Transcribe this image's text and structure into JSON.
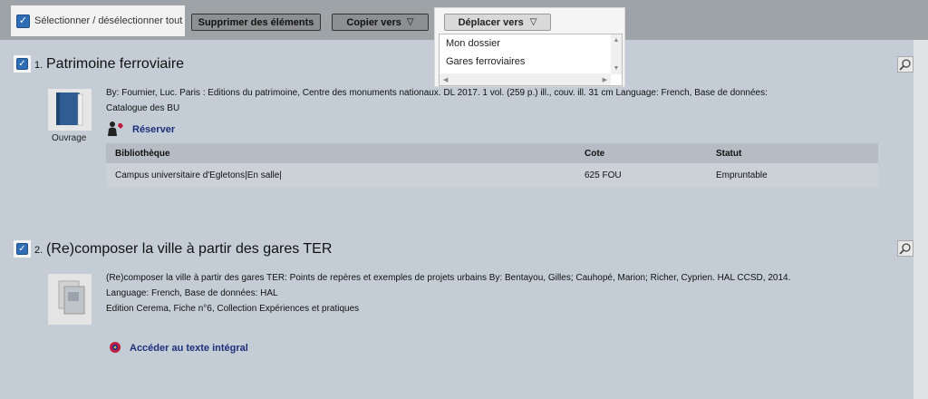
{
  "toolbar": {
    "select_all_label": "Sélectionner / désélectionner tout",
    "delete_label": "Supprimer des éléments",
    "copy_label": "Copier vers",
    "move_label": "Déplacer vers",
    "move_options": [
      "Mon dossier",
      "Gares ferroviaires"
    ]
  },
  "records": [
    {
      "number": "1.",
      "title": "Patrimoine ferroviaire",
      "type_label": "Ouvrage",
      "meta_line1": "By: Fournier, Luc. Paris : Editions du patrimoine, Centre des monuments nationaux. DL 2017. 1 vol. (259 p.) ill., couv. ill. 31 cm Language: French, Base de données:",
      "meta_line2": "Catalogue des BU",
      "reserve_label": "Réserver",
      "holdings": {
        "headers": [
          "Bibliothèque",
          "Cote",
          "Statut"
        ],
        "rows": [
          [
            "Campus universitaire d'Egletons|En salle|",
            "625 FOU",
            "Empruntable"
          ]
        ]
      }
    },
    {
      "number": "2.",
      "title": "(Re)composer la ville à partir des gares TER",
      "meta_line1": "(Re)composer la ville à partir des gares TER: Points de repères et exemples de projets urbains By: Bentayou, Gilles; Cauhopé, Marion; Richer, Cyprien. HAL CCSD, 2014.",
      "meta_line2": "Language: French, Base de données: HAL",
      "meta_line3": "Edition Cerema, Fiche n°6, Collection Expériences et pratiques",
      "fulltext_label": "Accéder au texte intégral"
    }
  ],
  "colors": {
    "background": "#c4cdd6",
    "toolbar": "#9ea3a8",
    "link": "#1c2f7a",
    "checkbox": "#2f6db5"
  }
}
